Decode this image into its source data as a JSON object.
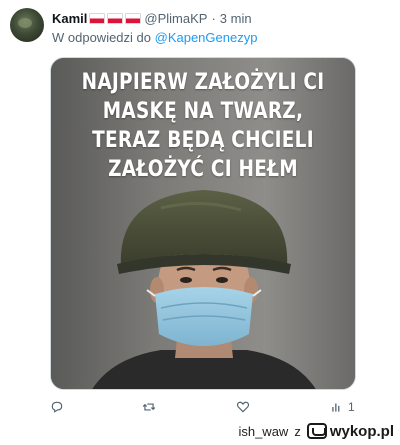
{
  "tweet": {
    "author_name": "Kamil",
    "author_handle": "@PlimaKP",
    "separator": "·",
    "time": "3 min",
    "flag_icons": [
      "poland-flag-icon",
      "poland-flag-icon",
      "poland-flag-icon"
    ],
    "reply_prefix": "W odpowiedzi do",
    "reply_mention": "@KapenGenezyp"
  },
  "media": {
    "caption_lines": [
      "NAJPIERW ZAŁOŻYLI CI",
      "MASKĘ NA TWARZ,",
      "TERAZ BĘDĄ CHCIELI",
      "ZAŁOŻYĆ CI HEŁM"
    ],
    "colors": {
      "helmet": "#4b4f38",
      "mask": "#8fc3dd",
      "background": "#7a7a78"
    }
  },
  "actions": {
    "reply_icon": "reply-icon",
    "retweet_icon": "retweet-icon",
    "like_icon": "heart-icon",
    "views_icon": "views-icon",
    "views_count": "1",
    "share_icon": "share-icon"
  },
  "watermark": {
    "user": "ish_waw",
    "connector": "z",
    "site": "wykop.pl"
  }
}
